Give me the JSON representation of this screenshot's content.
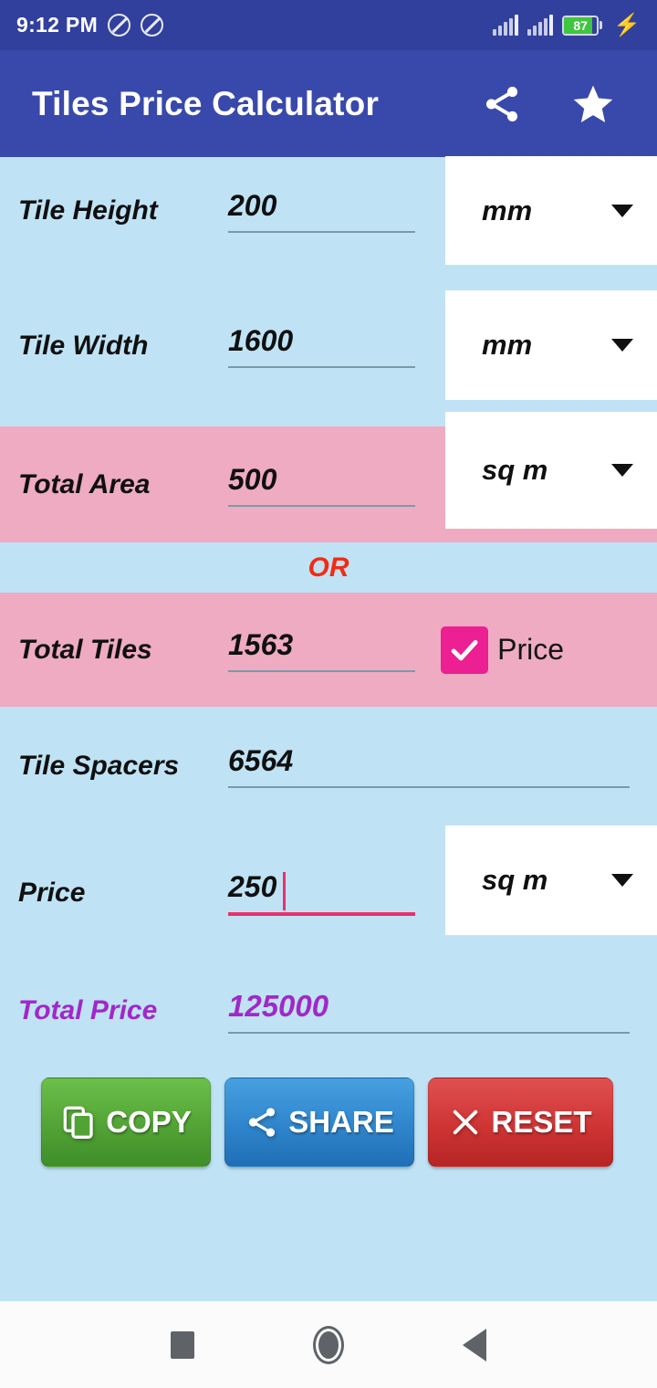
{
  "status_bar": {
    "time": "9:12 PM",
    "icons": [
      "dnd-icon",
      "dnd-icon",
      "signal-icon",
      "signal-icon"
    ],
    "battery_percent": "87",
    "charging_icon": "lightning-bolt-icon"
  },
  "app_bar": {
    "title": "Tiles Price Calculator",
    "share_icon": "share-icon",
    "favorite_icon": "star-icon",
    "background_color": "#3949ab"
  },
  "colors": {
    "blue_row": "#bfe3f5",
    "pink_row": "#eeabc2",
    "accent_pink": "#ec1f93",
    "focus_pink": "#ec2f6b",
    "or_red": "#f42a12",
    "total_purple": "#a128c8"
  },
  "form": {
    "rows": [
      {
        "label": "Tile Height",
        "value": "200",
        "unit": "mm",
        "highlight": "blue",
        "has_dropdown": true,
        "focused": false
      },
      {
        "label": "Tile Width",
        "value": "1600",
        "unit": "mm",
        "highlight": "blue",
        "has_dropdown": true,
        "focused": false
      },
      {
        "label": "Total Area",
        "value": "500",
        "unit": "sq m",
        "highlight": "pink",
        "has_dropdown": true,
        "focused": false
      },
      {
        "label": "Total Tiles",
        "value": "1563",
        "unit": "",
        "highlight": "pink",
        "has_dropdown": false,
        "focused": false
      },
      {
        "label": "Tile Spacers",
        "value": "6564",
        "unit": "",
        "highlight": "blue",
        "has_dropdown": false,
        "focused": false
      },
      {
        "label": "Price",
        "value": "250",
        "unit": "sq m",
        "highlight": "blue",
        "has_dropdown": true,
        "focused": true
      }
    ],
    "separator_text": "OR",
    "price_checkbox": {
      "label": "Price",
      "checked": true
    },
    "total": {
      "label": "Total Price",
      "value": "125000"
    }
  },
  "buttons": [
    {
      "label": "COPY",
      "icon": "copy-icon",
      "color": "#52a336"
    },
    {
      "label": "SHARE",
      "icon": "share-icon",
      "color": "#2f85cc"
    },
    {
      "label": "RESET",
      "icon": "close-x-icon",
      "color": "#cf3434"
    }
  ],
  "nav_bar": {
    "recents": "square-icon",
    "home": "circle-icon",
    "back": "triangle-back-icon"
  }
}
